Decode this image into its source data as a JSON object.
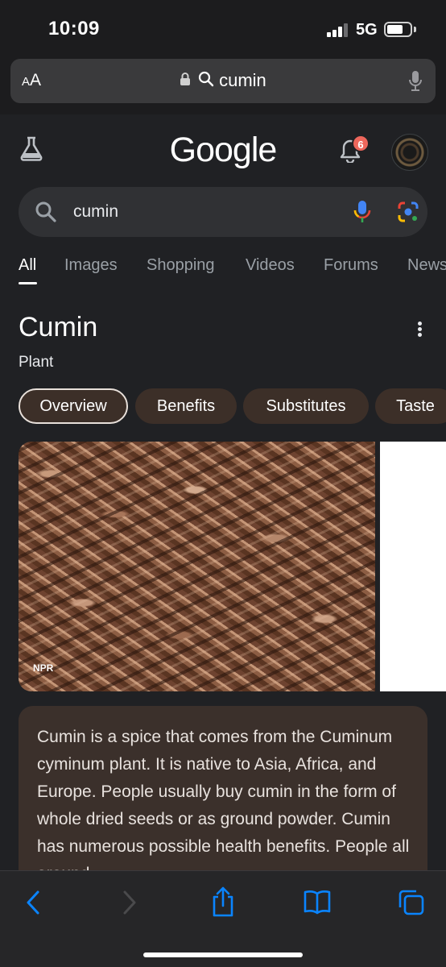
{
  "status_bar": {
    "time": "10:09",
    "network": "5G",
    "battery_level": 0.72
  },
  "safari": {
    "text_size_small": "A",
    "text_size_big": "A",
    "url_text": "cumin"
  },
  "google": {
    "logo": "Google",
    "notification_count": "6",
    "search_query": "cumin",
    "tabs": [
      "All",
      "Images",
      "Shopping",
      "Videos",
      "Forums",
      "News"
    ],
    "active_tab": "All"
  },
  "knowledge_panel": {
    "title": "Cumin",
    "subtitle": "Plant",
    "chips": [
      "Overview",
      "Benefits",
      "Substitutes",
      "Taste"
    ],
    "selected_chip": "Overview",
    "image_source": "NPR",
    "description": "Cumin is a spice that comes from the Cuminum cyminum plant. It is native to Asia, Africa, and Europe. People usually buy cumin in the form of whole dried seeds or as ground powder. Cumin has numerous possible health benefits. People all around"
  },
  "colors": {
    "background": "#202124",
    "chip_background": "#3c2f28",
    "card_background": "#3b302b",
    "toolbar_icon": "#0a84ff",
    "toolbar_icon_disabled": "#4a4a4c",
    "badge": "#ee675c"
  },
  "icons": {
    "safari": [
      "lock-icon",
      "search-icon",
      "microphone-icon"
    ],
    "google": [
      "labs-flask-icon",
      "bell-icon",
      "search-icon",
      "voice-search-icon",
      "lens-icon",
      "more-vert-icon"
    ],
    "toolbar": [
      "back-icon",
      "forward-icon",
      "share-icon",
      "bookmarks-icon",
      "tabs-icon"
    ]
  }
}
